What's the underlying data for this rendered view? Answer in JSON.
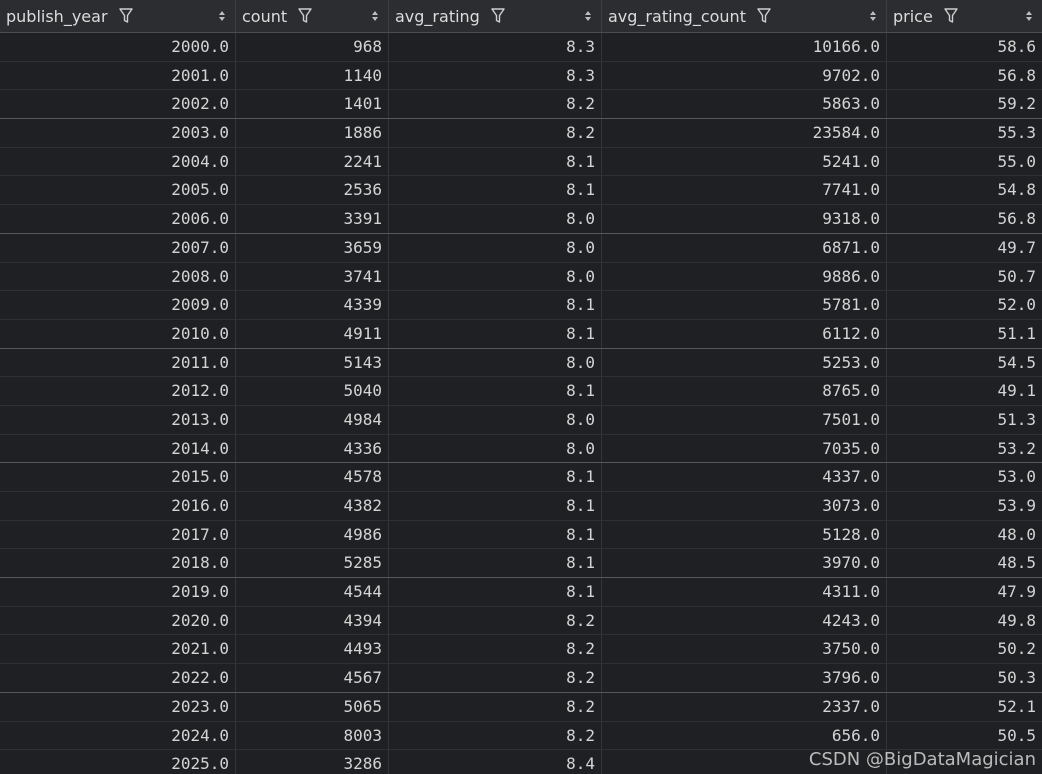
{
  "columns": [
    {
      "label": "publish_year",
      "icon_filter": "filter-icon",
      "icon_sort": "sort-icon"
    },
    {
      "label": "count",
      "icon_filter": "filter-icon",
      "icon_sort": "sort-icon"
    },
    {
      "label": "avg_rating",
      "icon_filter": "filter-icon",
      "icon_sort": "sort-icon"
    },
    {
      "label": "avg_rating_count",
      "icon_filter": "filter-icon",
      "icon_sort": "sort-icon"
    },
    {
      "label": "price",
      "icon_filter": "filter-icon",
      "icon_sort": "sort-icon"
    }
  ],
  "rows": [
    [
      "2000.0",
      "968",
      "8.3",
      "10166.0",
      "58.6"
    ],
    [
      "2001.0",
      "1140",
      "8.3",
      "9702.0",
      "56.8"
    ],
    [
      "2002.0",
      "1401",
      "8.2",
      "5863.0",
      "59.2"
    ],
    [
      "2003.0",
      "1886",
      "8.2",
      "23584.0",
      "55.3"
    ],
    [
      "2004.0",
      "2241",
      "8.1",
      "5241.0",
      "55.0"
    ],
    [
      "2005.0",
      "2536",
      "8.1",
      "7741.0",
      "54.8"
    ],
    [
      "2006.0",
      "3391",
      "8.0",
      "9318.0",
      "56.8"
    ],
    [
      "2007.0",
      "3659",
      "8.0",
      "6871.0",
      "49.7"
    ],
    [
      "2008.0",
      "3741",
      "8.0",
      "9886.0",
      "50.7"
    ],
    [
      "2009.0",
      "4339",
      "8.1",
      "5781.0",
      "52.0"
    ],
    [
      "2010.0",
      "4911",
      "8.1",
      "6112.0",
      "51.1"
    ],
    [
      "2011.0",
      "5143",
      "8.0",
      "5253.0",
      "54.5"
    ],
    [
      "2012.0",
      "5040",
      "8.1",
      "8765.0",
      "49.1"
    ],
    [
      "2013.0",
      "4984",
      "8.0",
      "7501.0",
      "51.3"
    ],
    [
      "2014.0",
      "4336",
      "8.0",
      "7035.0",
      "53.2"
    ],
    [
      "2015.0",
      "4578",
      "8.1",
      "4337.0",
      "53.0"
    ],
    [
      "2016.0",
      "4382",
      "8.1",
      "3073.0",
      "53.9"
    ],
    [
      "2017.0",
      "4986",
      "8.1",
      "5128.0",
      "48.0"
    ],
    [
      "2018.0",
      "5285",
      "8.1",
      "3970.0",
      "48.5"
    ],
    [
      "2019.0",
      "4544",
      "8.1",
      "4311.0",
      "47.9"
    ],
    [
      "2020.0",
      "4394",
      "8.2",
      "4243.0",
      "49.8"
    ],
    [
      "2021.0",
      "4493",
      "8.2",
      "3750.0",
      "50.2"
    ],
    [
      "2022.0",
      "4567",
      "8.2",
      "3796.0",
      "50.3"
    ],
    [
      "2023.0",
      "5065",
      "8.2",
      "2337.0",
      "52.1"
    ],
    [
      "2024.0",
      "8003",
      "8.2",
      "656.0",
      "50.5"
    ],
    [
      "2025.0",
      "3286",
      "8.4",
      "",
      ""
    ]
  ],
  "watermark": "CSDN @BigDataMagician",
  "colors": {
    "background": "#1f2023",
    "header_background": "#2b2d30",
    "text": "#d4d4d4"
  }
}
